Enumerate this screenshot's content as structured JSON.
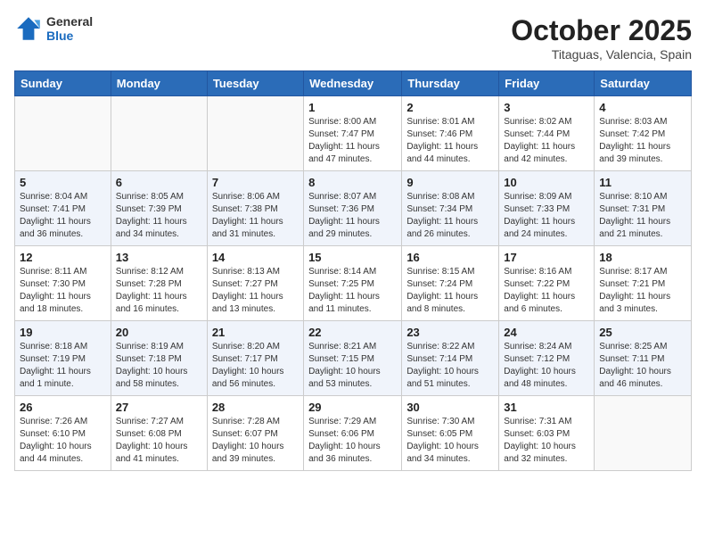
{
  "header": {
    "logo_general": "General",
    "logo_blue": "Blue",
    "month": "October 2025",
    "location": "Titaguas, Valencia, Spain"
  },
  "weekdays": [
    "Sunday",
    "Monday",
    "Tuesday",
    "Wednesday",
    "Thursday",
    "Friday",
    "Saturday"
  ],
  "weeks": [
    [
      {
        "day": "",
        "info": ""
      },
      {
        "day": "",
        "info": ""
      },
      {
        "day": "",
        "info": ""
      },
      {
        "day": "1",
        "info": "Sunrise: 8:00 AM\nSunset: 7:47 PM\nDaylight: 11 hours and 47 minutes."
      },
      {
        "day": "2",
        "info": "Sunrise: 8:01 AM\nSunset: 7:46 PM\nDaylight: 11 hours and 44 minutes."
      },
      {
        "day": "3",
        "info": "Sunrise: 8:02 AM\nSunset: 7:44 PM\nDaylight: 11 hours and 42 minutes."
      },
      {
        "day": "4",
        "info": "Sunrise: 8:03 AM\nSunset: 7:42 PM\nDaylight: 11 hours and 39 minutes."
      }
    ],
    [
      {
        "day": "5",
        "info": "Sunrise: 8:04 AM\nSunset: 7:41 PM\nDaylight: 11 hours and 36 minutes."
      },
      {
        "day": "6",
        "info": "Sunrise: 8:05 AM\nSunset: 7:39 PM\nDaylight: 11 hours and 34 minutes."
      },
      {
        "day": "7",
        "info": "Sunrise: 8:06 AM\nSunset: 7:38 PM\nDaylight: 11 hours and 31 minutes."
      },
      {
        "day": "8",
        "info": "Sunrise: 8:07 AM\nSunset: 7:36 PM\nDaylight: 11 hours and 29 minutes."
      },
      {
        "day": "9",
        "info": "Sunrise: 8:08 AM\nSunset: 7:34 PM\nDaylight: 11 hours and 26 minutes."
      },
      {
        "day": "10",
        "info": "Sunrise: 8:09 AM\nSunset: 7:33 PM\nDaylight: 11 hours and 24 minutes."
      },
      {
        "day": "11",
        "info": "Sunrise: 8:10 AM\nSunset: 7:31 PM\nDaylight: 11 hours and 21 minutes."
      }
    ],
    [
      {
        "day": "12",
        "info": "Sunrise: 8:11 AM\nSunset: 7:30 PM\nDaylight: 11 hours and 18 minutes."
      },
      {
        "day": "13",
        "info": "Sunrise: 8:12 AM\nSunset: 7:28 PM\nDaylight: 11 hours and 16 minutes."
      },
      {
        "day": "14",
        "info": "Sunrise: 8:13 AM\nSunset: 7:27 PM\nDaylight: 11 hours and 13 minutes."
      },
      {
        "day": "15",
        "info": "Sunrise: 8:14 AM\nSunset: 7:25 PM\nDaylight: 11 hours and 11 minutes."
      },
      {
        "day": "16",
        "info": "Sunrise: 8:15 AM\nSunset: 7:24 PM\nDaylight: 11 hours and 8 minutes."
      },
      {
        "day": "17",
        "info": "Sunrise: 8:16 AM\nSunset: 7:22 PM\nDaylight: 11 hours and 6 minutes."
      },
      {
        "day": "18",
        "info": "Sunrise: 8:17 AM\nSunset: 7:21 PM\nDaylight: 11 hours and 3 minutes."
      }
    ],
    [
      {
        "day": "19",
        "info": "Sunrise: 8:18 AM\nSunset: 7:19 PM\nDaylight: 11 hours and 1 minute."
      },
      {
        "day": "20",
        "info": "Sunrise: 8:19 AM\nSunset: 7:18 PM\nDaylight: 10 hours and 58 minutes."
      },
      {
        "day": "21",
        "info": "Sunrise: 8:20 AM\nSunset: 7:17 PM\nDaylight: 10 hours and 56 minutes."
      },
      {
        "day": "22",
        "info": "Sunrise: 8:21 AM\nSunset: 7:15 PM\nDaylight: 10 hours and 53 minutes."
      },
      {
        "day": "23",
        "info": "Sunrise: 8:22 AM\nSunset: 7:14 PM\nDaylight: 10 hours and 51 minutes."
      },
      {
        "day": "24",
        "info": "Sunrise: 8:24 AM\nSunset: 7:12 PM\nDaylight: 10 hours and 48 minutes."
      },
      {
        "day": "25",
        "info": "Sunrise: 8:25 AM\nSunset: 7:11 PM\nDaylight: 10 hours and 46 minutes."
      }
    ],
    [
      {
        "day": "26",
        "info": "Sunrise: 7:26 AM\nSunset: 6:10 PM\nDaylight: 10 hours and 44 minutes."
      },
      {
        "day": "27",
        "info": "Sunrise: 7:27 AM\nSunset: 6:08 PM\nDaylight: 10 hours and 41 minutes."
      },
      {
        "day": "28",
        "info": "Sunrise: 7:28 AM\nSunset: 6:07 PM\nDaylight: 10 hours and 39 minutes."
      },
      {
        "day": "29",
        "info": "Sunrise: 7:29 AM\nSunset: 6:06 PM\nDaylight: 10 hours and 36 minutes."
      },
      {
        "day": "30",
        "info": "Sunrise: 7:30 AM\nSunset: 6:05 PM\nDaylight: 10 hours and 34 minutes."
      },
      {
        "day": "31",
        "info": "Sunrise: 7:31 AM\nSunset: 6:03 PM\nDaylight: 10 hours and 32 minutes."
      },
      {
        "day": "",
        "info": ""
      }
    ]
  ]
}
